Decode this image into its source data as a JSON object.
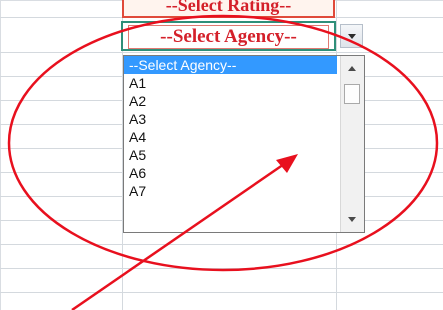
{
  "rating_cell": {
    "text": "--Select Rating--"
  },
  "agency_cell": {
    "text": "--Select Agency--"
  },
  "dropdown_button": {
    "icon": "chevron-down-icon"
  },
  "listbox": {
    "items": [
      "--Select Agency--",
      "A1",
      "A2",
      "A3",
      "A4",
      "A5",
      "A6",
      "A7"
    ],
    "selected_index": 0
  },
  "scrollbar": {
    "up_icon": "arrow-up-icon",
    "down_icon": "arrow-down-icon"
  },
  "annotation": {
    "ellipse_color": "#e8101e",
    "arrow_color": "#e8101e"
  },
  "colors": {
    "selection": "#3399ff",
    "cell_text": "#d4202a",
    "active_cell_border": "#2f8f79"
  }
}
